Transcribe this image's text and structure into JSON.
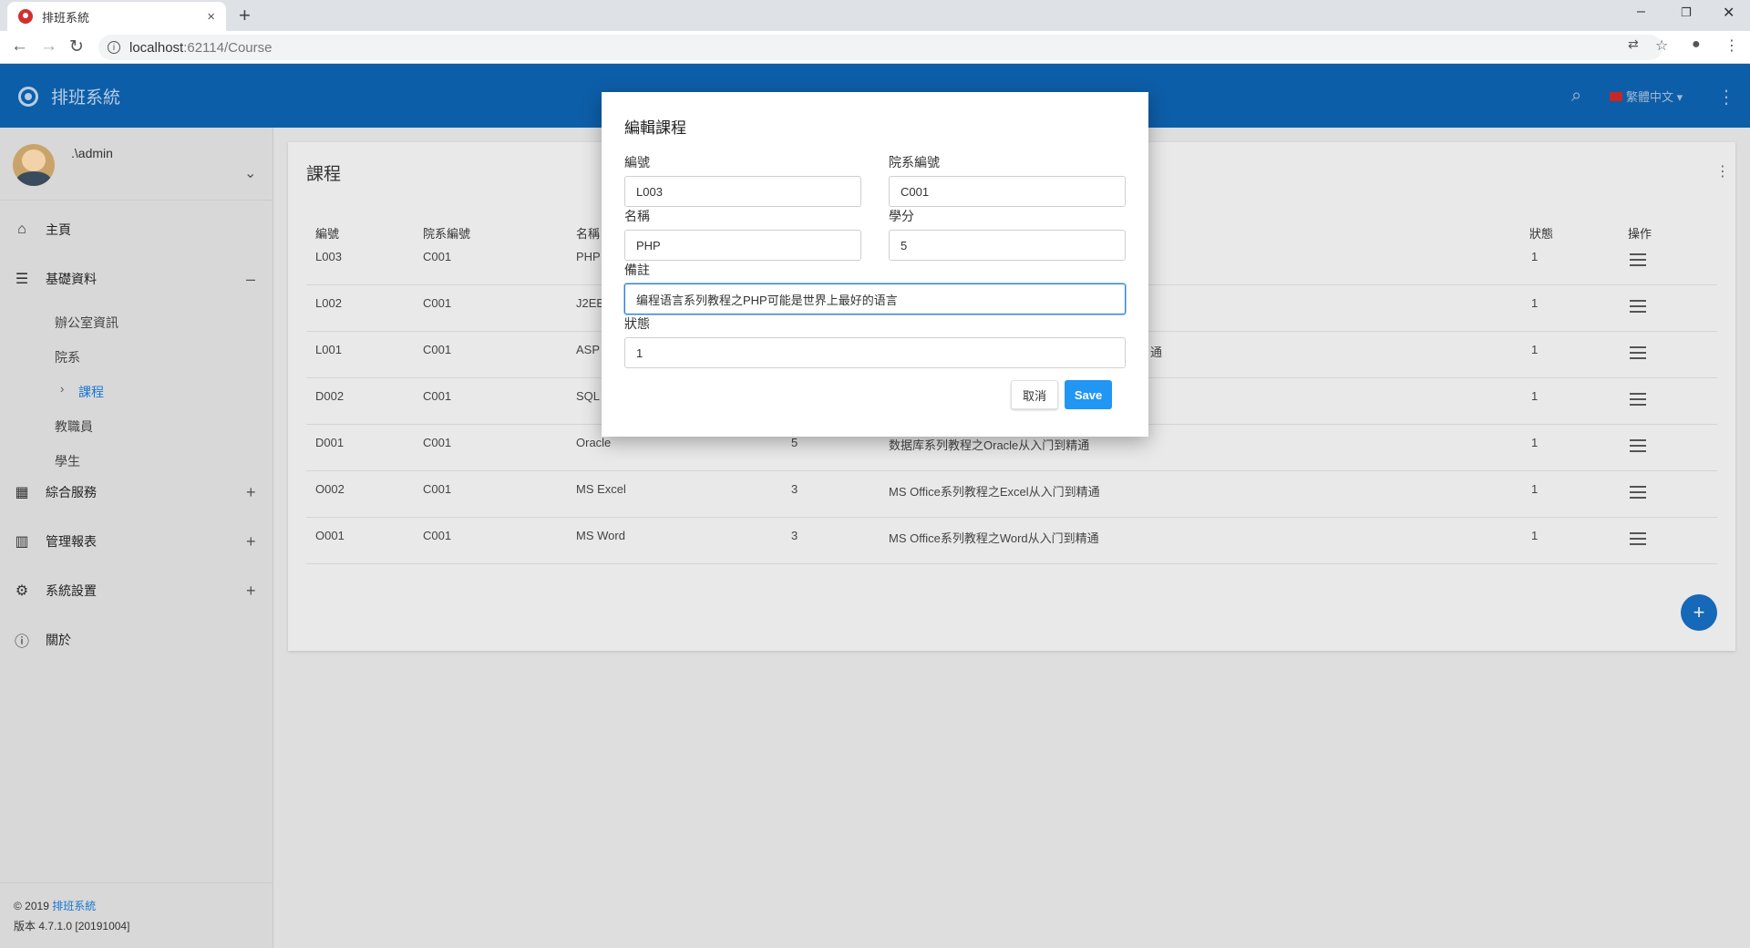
{
  "browser": {
    "tab_title": "排班系統",
    "tab_close": "×",
    "new_tab": "+",
    "url_host": "localhost",
    "url_rest": ":62114/Course",
    "win_min": "–",
    "win_restore": "❐",
    "win_close": "✕"
  },
  "header": {
    "brand": "排班系統",
    "language": "繁體中文 ▾"
  },
  "sidebar": {
    "username": ".\\admin",
    "items": [
      {
        "label": "主頁"
      },
      {
        "label": "基礎資料",
        "right": "–"
      },
      {
        "label": "綜合服務",
        "right": "+"
      },
      {
        "label": "管理報表",
        "right": "+"
      },
      {
        "label": "系統設置",
        "right": "+"
      },
      {
        "label": "關於"
      }
    ],
    "subitems": [
      {
        "label": "辦公室資訊"
      },
      {
        "label": "院系"
      },
      {
        "label": "課程"
      },
      {
        "label": "教職員"
      },
      {
        "label": "學生"
      }
    ],
    "footer_copyright": "© 2019 ",
    "footer_link": "排班系統",
    "footer_version": "版本 4.7.1.0 [20191004]"
  },
  "page": {
    "title": "課程",
    "columns": [
      "編號",
      "院系編號",
      "名稱",
      "狀態",
      "操作"
    ],
    "rows": [
      {
        "id": "L003",
        "dept": "C001",
        "name": "PHP",
        "credit": "",
        "remark": "",
        "status": "1"
      },
      {
        "id": "L002",
        "dept": "C001",
        "name": "J2EE",
        "credit": "",
        "remark": "",
        "status": "1"
      },
      {
        "id": "L001",
        "dept": "C001",
        "name": "ASP",
        "credit": "",
        "remark": "通",
        "status": "1"
      },
      {
        "id": "D002",
        "dept": "C001",
        "name": "SQL",
        "credit": "",
        "remark": "",
        "status": "1"
      },
      {
        "id": "D001",
        "dept": "C001",
        "name": "Oracle",
        "credit": "5",
        "remark": "数据库系列教程之Oracle从入门到精通",
        "status": "1"
      },
      {
        "id": "O002",
        "dept": "C001",
        "name": "MS Excel",
        "credit": "3",
        "remark": "MS Office系列教程之Excel从入门到精通",
        "status": "1"
      },
      {
        "id": "O001",
        "dept": "C001",
        "name": "MS Word",
        "credit": "3",
        "remark": "MS Office系列教程之Word从入门到精通",
        "status": "1"
      }
    ],
    "fab": "+"
  },
  "modal": {
    "title": "編輯課程",
    "fields": {
      "id_label": "編號",
      "id_value": "L003",
      "dept_label": "院系編號",
      "dept_value": "C001",
      "name_label": "名稱",
      "name_value": "PHP",
      "credit_label": "學分",
      "credit_value": "5",
      "remark_label": "備註",
      "remark_value": "编程语言系列教程之PHP可能是世界上最好的语言",
      "status_label": "狀態",
      "status_value": "1"
    },
    "cancel": "取消",
    "save": "Save"
  },
  "colors": {
    "appbar": "#0d5ea8",
    "accent": "#2196f3",
    "active_link": "#1976d2"
  }
}
